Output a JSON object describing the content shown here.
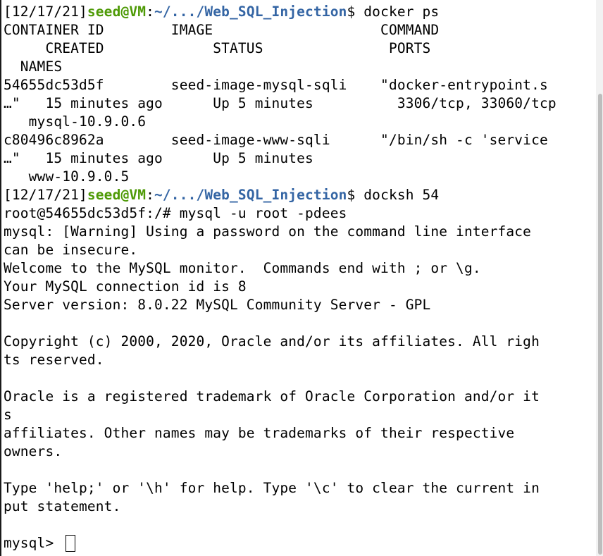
{
  "prompt": {
    "date": "[12/17/21]",
    "user_host": "seed@VM",
    "sep": ":",
    "path": "~/.../Web_SQL_Injection",
    "symbol": "$"
  },
  "commands": {
    "first": " docker ps",
    "second": " docksh 54"
  },
  "docker_ps": {
    "header_1": "CONTAINER ID        IMAGE                    COMMAND",
    "header_2": "     CREATED             STATUS               PORTS",
    "header_3": "  NAMES",
    "row1_a": "54655dc53d5f        seed-image-mysql-sqli    \"docker-entrypoint.s",
    "row1_b": "…\"   15 minutes ago      Up 5 minutes          3306/tcp, 33060/tcp",
    "row1_c": "   mysql-10.9.0.6",
    "row2_a": "c80496c8962a        seed-image-www-sqli      \"/bin/sh -c 'service",
    "row2_b": "…\"   15 minutes ago      Up 5 minutes",
    "row2_c": "   www-10.9.0.5"
  },
  "session": [
    "root@54655dc53d5f:/# mysql -u root -pdees",
    "mysql: [Warning] Using a password on the command line interface",
    "can be insecure.",
    "Welcome to the MySQL monitor.  Commands end with ; or \\g.",
    "Your MySQL connection id is 8",
    "Server version: 8.0.22 MySQL Community Server - GPL",
    "",
    "Copyright (c) 2000, 2020, Oracle and/or its affiliates. All righ",
    "ts reserved.",
    "",
    "Oracle is a registered trademark of Oracle Corporation and/or it",
    "s",
    "affiliates. Other names may be trademarks of their respective",
    "owners.",
    "",
    "Type 'help;' or '\\h' for help. Type '\\c' to clear the current in",
    "put statement.",
    ""
  ],
  "mysql_prompt": "mysql> "
}
